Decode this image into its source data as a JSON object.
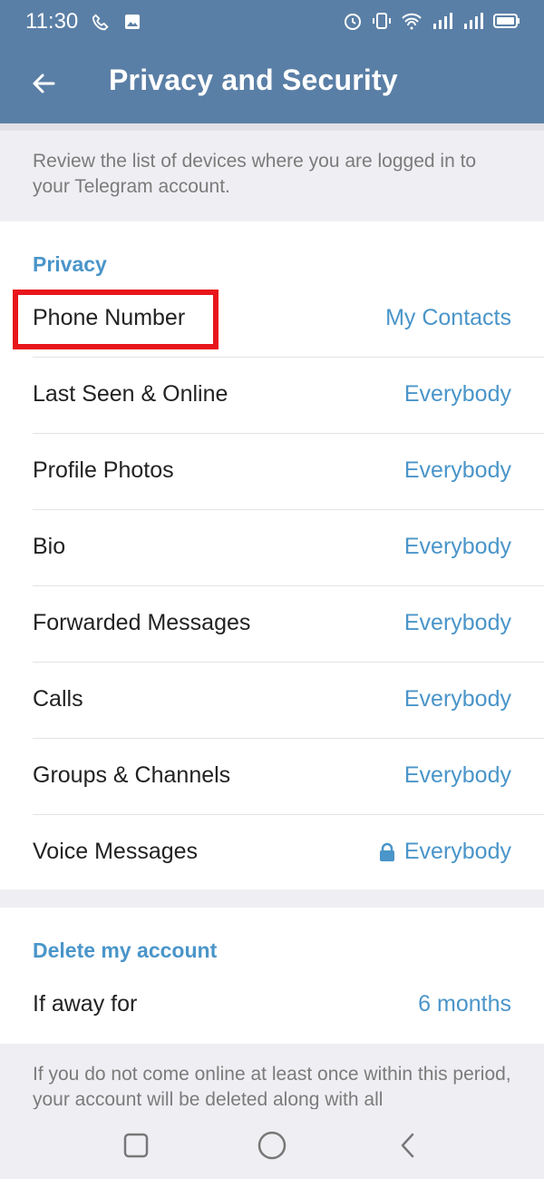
{
  "status_bar": {
    "time": "11:30",
    "left_icons": [
      "phone-call-icon",
      "image-icon"
    ],
    "right_icons": [
      "alarm-icon",
      "vibrate-icon",
      "wifi-icon",
      "signal-icon",
      "signal-icon",
      "battery-icon"
    ]
  },
  "header": {
    "title": "Privacy and Security"
  },
  "info": {
    "text": "Review the list of devices where you are logged in to your Telegram account."
  },
  "privacy": {
    "header": "Privacy",
    "items": [
      {
        "label": "Phone Number",
        "value": "My Contacts"
      },
      {
        "label": "Last Seen & Online",
        "value": "Everybody"
      },
      {
        "label": "Profile Photos",
        "value": "Everybody"
      },
      {
        "label": "Bio",
        "value": "Everybody"
      },
      {
        "label": "Forwarded Messages",
        "value": "Everybody"
      },
      {
        "label": "Calls",
        "value": "Everybody"
      },
      {
        "label": "Groups & Channels",
        "value": "Everybody"
      },
      {
        "label": "Voice Messages",
        "value": "Everybody",
        "icon": "lock-icon"
      }
    ]
  },
  "delete_account": {
    "header": "Delete my account",
    "item": {
      "label": "If away for",
      "value": "6 months"
    }
  },
  "footer_note": {
    "text": "If you do not come online at least once within this period, your account will be deleted along with all"
  },
  "colors": {
    "app_bar": "#5a7fa6",
    "accent": "#4a95c9",
    "highlight": "#e8161c"
  },
  "nav_icons": [
    "recent-apps-icon",
    "home-icon",
    "back-icon"
  ]
}
